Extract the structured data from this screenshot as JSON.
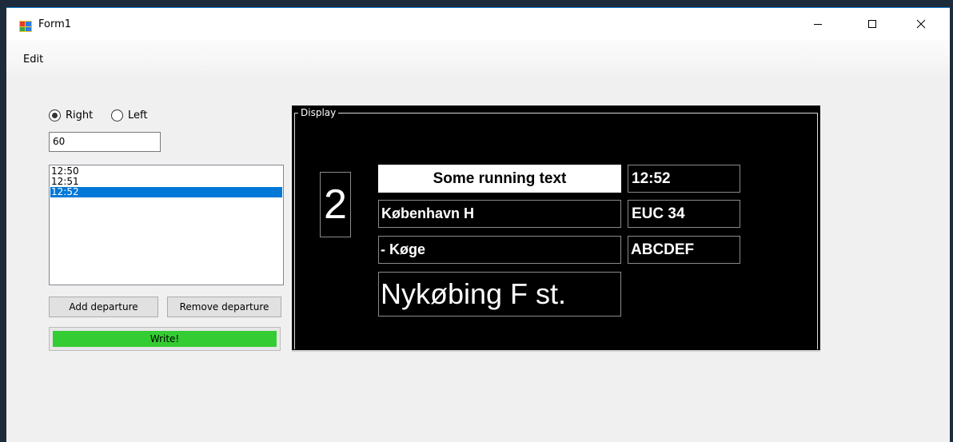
{
  "window": {
    "title": "Form1"
  },
  "menu": {
    "edit": "Edit"
  },
  "controls": {
    "radio_right": {
      "label": "Right",
      "checked": true
    },
    "radio_left": {
      "label": "Left",
      "checked": false
    },
    "number_value": "60",
    "departures": [
      "12:50",
      "12:51",
      "12:52"
    ],
    "selected_departure": "12:52",
    "add_button": "Add departure",
    "remove_button": "Remove departure",
    "write_button": "Write!"
  },
  "display": {
    "legend": "Display",
    "track": "2",
    "running_text": "Some running text",
    "time": "12:52",
    "origin": "København H",
    "train": "EUC 34",
    "via": "- Køge",
    "code": "ABCDEF",
    "destination": "Nykøbing F st."
  },
  "colors": {
    "accent": "#0078d7",
    "write_green": "#33cc33",
    "display_bg": "#000000"
  }
}
